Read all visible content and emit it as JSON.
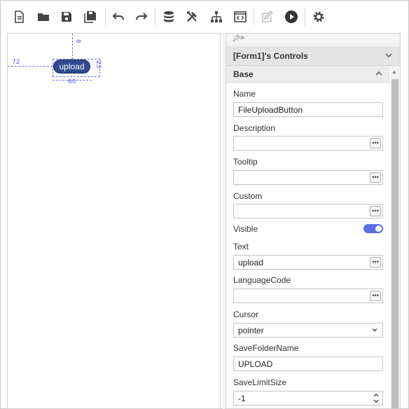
{
  "toolbar": {
    "buttons": [
      {
        "icon": "new-file-icon"
      },
      {
        "icon": "open-folder-icon"
      },
      {
        "icon": "save-icon"
      },
      {
        "icon": "save-all-icon"
      },
      {
        "icon": "undo-icon"
      },
      {
        "icon": "redo-icon"
      },
      {
        "icon": "database-icon"
      },
      {
        "icon": "tools-icon"
      },
      {
        "icon": "hierarchy-icon"
      },
      {
        "icon": "code-icon"
      },
      {
        "icon": "edit-icon"
      },
      {
        "icon": "play-icon"
      },
      {
        "icon": "settings-icon"
      }
    ]
  },
  "canvas": {
    "guide_top": "8",
    "guide_left": "72",
    "guide_height": "23",
    "guide_width": "60",
    "control_label": "upload"
  },
  "panel": {
    "header": "[Form1]'s Controls",
    "section": "Base",
    "props": {
      "name_label": "Name",
      "name_value": "FileUploadButton",
      "description_label": "Description",
      "description_value": "",
      "tooltip_label": "Tooltip",
      "tooltip_value": "",
      "custom_label": "Custom",
      "custom_value": "",
      "visible_label": "Visible",
      "visible_value": true,
      "text_label": "Text",
      "text_value": "upload",
      "languagecode_label": "LanguageCode",
      "languagecode_value": "",
      "cursor_label": "Cursor",
      "cursor_value": "pointer",
      "savefoldername_label": "SaveFolderName",
      "savefoldername_value": "UPLOAD",
      "savelimitsize_label": "SaveLimitSize",
      "savelimitsize_value": "-1"
    }
  },
  "colors": {
    "accent": "#5b6fe8",
    "control_fill": "#2f4a8f",
    "guide": "#6f6ff0"
  }
}
